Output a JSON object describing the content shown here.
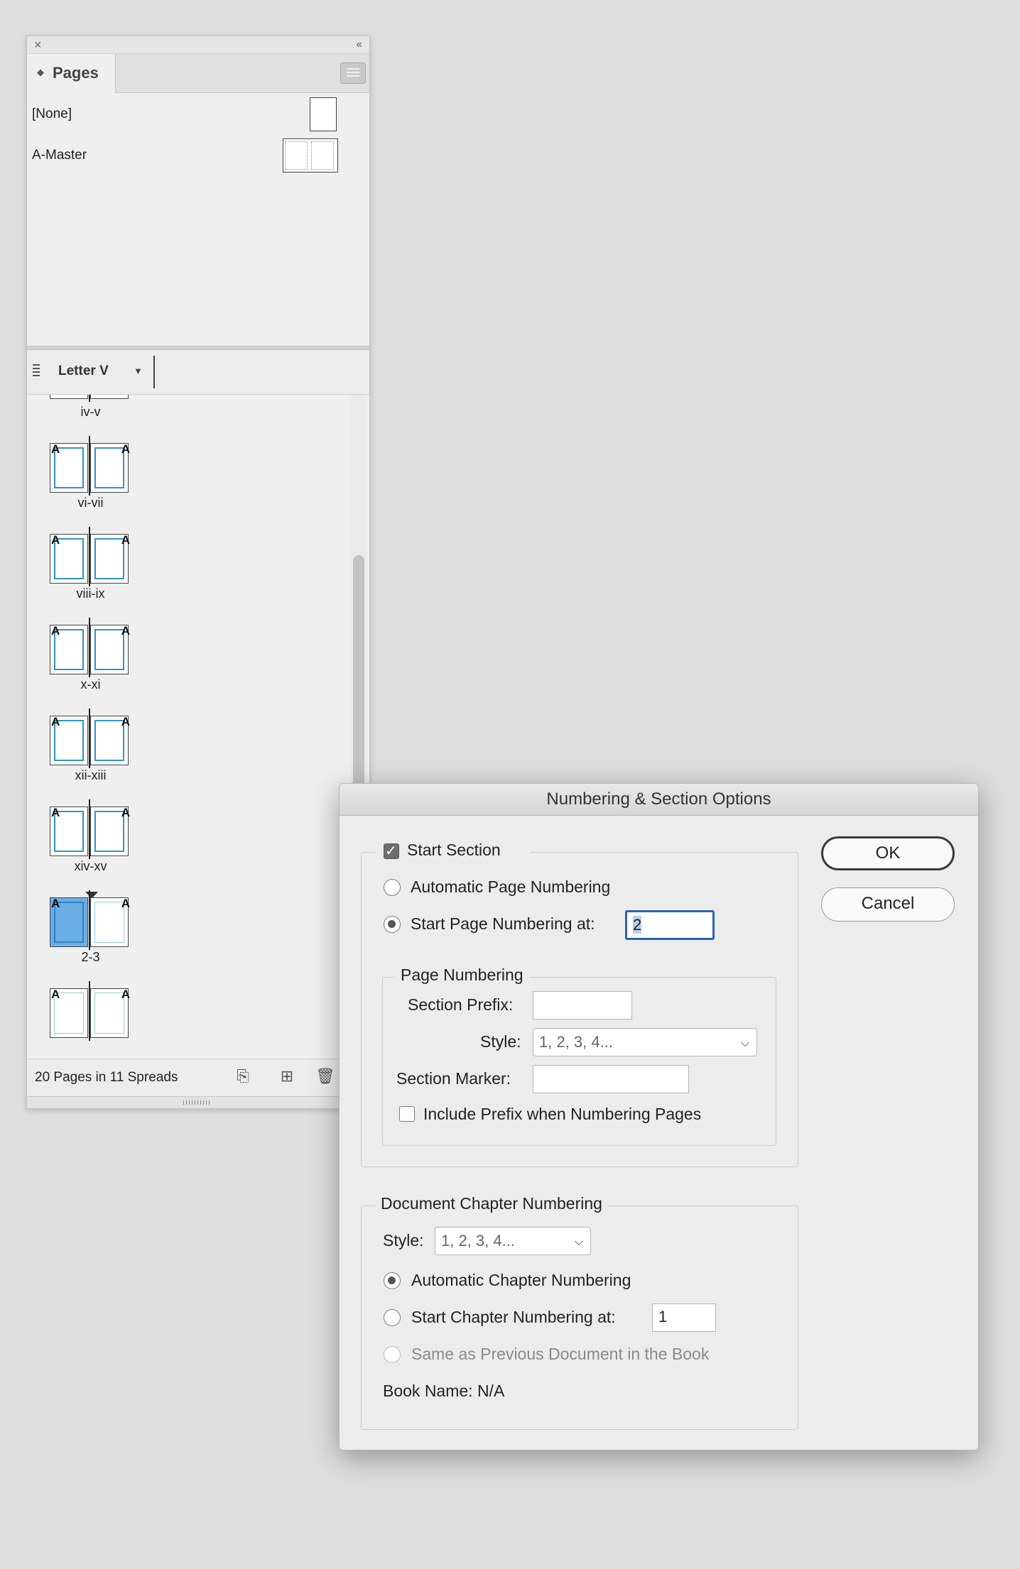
{
  "pages_panel": {
    "close_glyph": "×",
    "collapse_glyph": "‹‹",
    "tab_label": "Pages",
    "masters": [
      {
        "label": "[None]"
      },
      {
        "label": "A-Master"
      }
    ],
    "page_size": "Letter V",
    "spreads": [
      {
        "label": "iv-v"
      },
      {
        "label": "vi-vii"
      },
      {
        "label": "viii-ix"
      },
      {
        "label": "x-xi"
      },
      {
        "label": "xii-xiii"
      },
      {
        "label": "xiv-xv"
      },
      {
        "label": "2-3"
      }
    ],
    "master_letter": "A",
    "status": "20 Pages in 11 Spreads"
  },
  "dialog": {
    "title": "Numbering & Section Options",
    "start_section": {
      "label": "Start Section",
      "checked": true
    },
    "auto_page_numbering": "Automatic Page Numbering",
    "start_page_numbering": {
      "label": "Start Page Numbering at:",
      "value": "2"
    },
    "page_numbering": {
      "legend": "Page Numbering",
      "section_prefix_label": "Section Prefix:",
      "section_prefix_value": "",
      "style_label": "Style:",
      "style_value": "1, 2, 3, 4...",
      "section_marker_label": "Section Marker:",
      "section_marker_value": "",
      "include_prefix_label": "Include Prefix when Numbering Pages"
    },
    "chapter_numbering": {
      "legend": "Document Chapter Numbering",
      "style_label": "Style:",
      "style_value": "1, 2, 3, 4...",
      "automatic_label": "Automatic Chapter Numbering",
      "start_label": "Start Chapter Numbering at:",
      "start_value": "1",
      "same_as_previous_label": "Same as Previous Document in the Book",
      "book_name": "Book Name: N/A"
    },
    "ok_label": "OK",
    "cancel_label": "Cancel"
  }
}
